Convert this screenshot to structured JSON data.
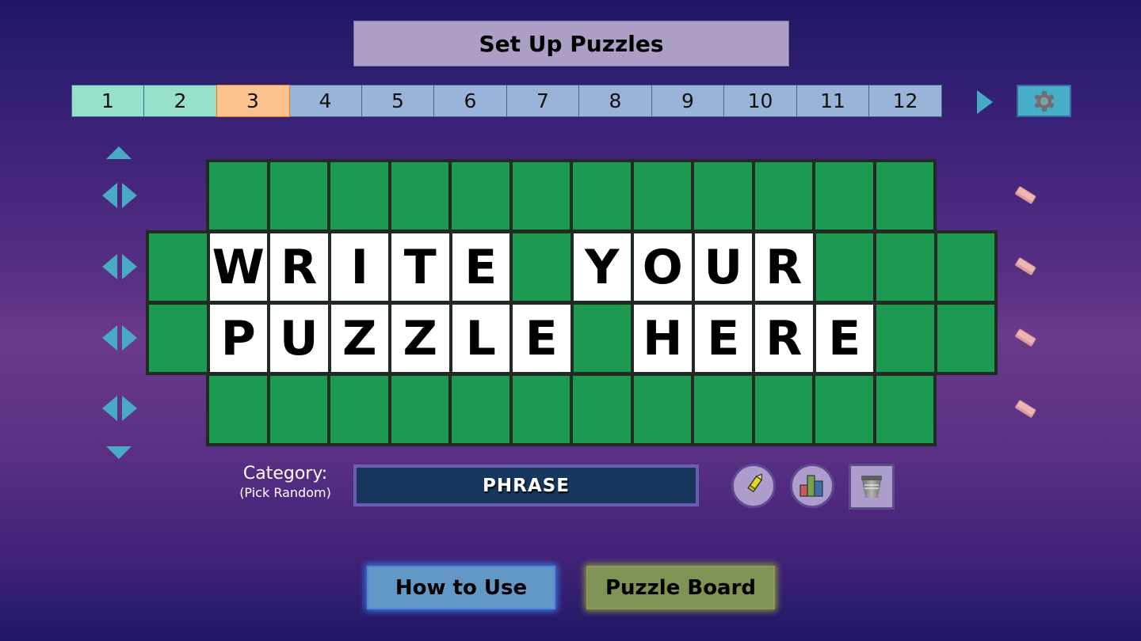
{
  "header": {
    "title": "Set Up Puzzles"
  },
  "puzzle_tabs": {
    "items": [
      {
        "label": "1",
        "state": "done"
      },
      {
        "label": "2",
        "state": "done"
      },
      {
        "label": "3",
        "state": "active"
      },
      {
        "label": "4",
        "state": "default"
      },
      {
        "label": "5",
        "state": "default"
      },
      {
        "label": "6",
        "state": "default"
      },
      {
        "label": "7",
        "state": "default"
      },
      {
        "label": "8",
        "state": "default"
      },
      {
        "label": "9",
        "state": "default"
      },
      {
        "label": "10",
        "state": "default"
      },
      {
        "label": "11",
        "state": "default"
      },
      {
        "label": "12",
        "state": "default"
      }
    ],
    "next_icon": "triangle-right-icon",
    "settings_icon": "gear-icon"
  },
  "board": {
    "rows": [
      [
        "",
        "",
        "",
        "",
        "",
        "",
        "",
        "",
        "",
        "",
        "",
        ""
      ],
      [
        "",
        "W",
        "R",
        "I",
        "T",
        "E",
        "",
        "Y",
        "O",
        "U",
        "R",
        "",
        "",
        ""
      ],
      [
        "",
        "P",
        "U",
        "Z",
        "Z",
        "L",
        "E",
        "",
        "H",
        "E",
        "R",
        "E",
        "",
        ""
      ],
      [
        "",
        "",
        "",
        "",
        "",
        "",
        "",
        "",
        "",
        "",
        "",
        ""
      ]
    ],
    "row_controls": {
      "up_icon": "triangle-up-icon",
      "down_icon": "triangle-down-icon",
      "shift_left_icon": "triangle-left-icon",
      "shift_right_icon": "triangle-right-icon",
      "clear_row_icon": "eraser-icon"
    }
  },
  "category": {
    "label": "Category:",
    "sublabel": "(Pick Random)",
    "value": "PHRASE"
  },
  "tools": [
    {
      "name": "edit",
      "icon": "pencil-icon"
    },
    {
      "name": "stats",
      "icon": "bar-chart-icon"
    },
    {
      "name": "clear",
      "icon": "trash-bin-icon"
    }
  ],
  "footer": {
    "how_to_use": "How to Use",
    "puzzle_board": "Puzzle Board"
  },
  "colors": {
    "tile_blank": "#1c9a52",
    "tile_letter": "#ffffff",
    "tab_done": "#96e0cc",
    "tab_active": "#fbc28f",
    "tab_default": "#9ab4d9",
    "accent": "#48aac4"
  }
}
